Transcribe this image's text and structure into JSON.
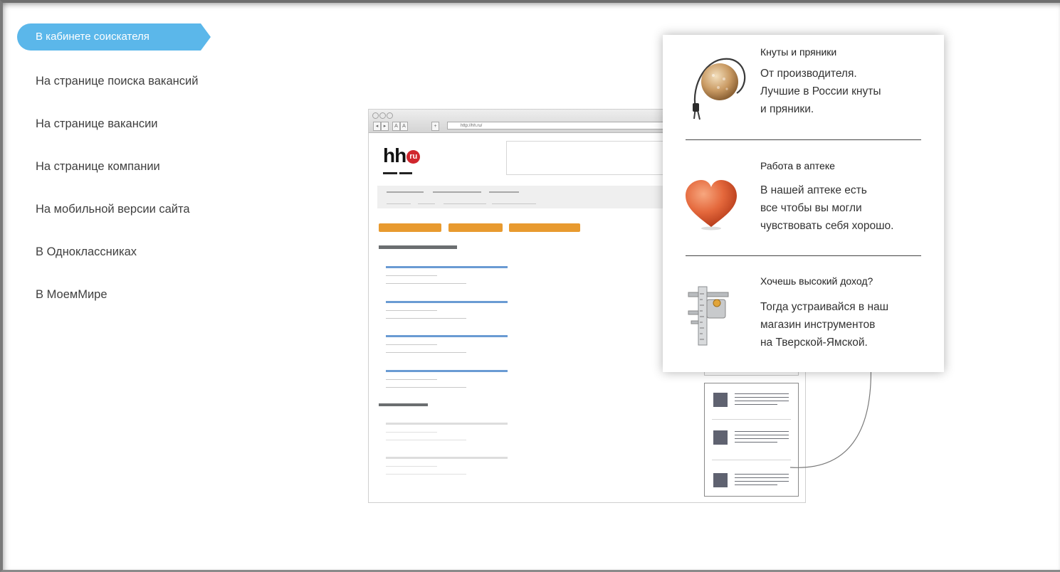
{
  "menu": {
    "active": "В кабинете соискателя",
    "items": [
      "На странице поиска вакансий",
      "На странице вакансии",
      "На странице компании",
      "На мобильной версии сайта",
      "В Одноклассниках",
      "В МоемМире"
    ]
  },
  "browser": {
    "url": "http://hh.ru/",
    "logo": "hh",
    "logo_badge": "ru",
    "toolbar": [
      "◂",
      "▸",
      "A",
      "A",
      "+"
    ]
  },
  "ads": [
    {
      "title": "Кнуты и пряники",
      "lines": [
        "От производителя.",
        "Лучшие в России кнуты",
        "и пряники."
      ],
      "icon": "whip-cookie-icon"
    },
    {
      "title": "Работа в аптеке",
      "lines": [
        "В нашей аптеке есть",
        "все чтобы вы могли",
        "чувствовать себя  хорошо."
      ],
      "icon": "heart-icon"
    },
    {
      "title": "Хочешь высокий доход?",
      "lines": [
        "Тогда устраивайся в наш",
        "магазин инструментов",
        "на Тверской-Ямской."
      ],
      "icon": "caliper-icon"
    }
  ],
  "colors": {
    "active_tab": "#5bb7ea",
    "hh_red": "#d0262d",
    "orange": "#e89a2f",
    "blue_link": "#6a9bd3"
  }
}
